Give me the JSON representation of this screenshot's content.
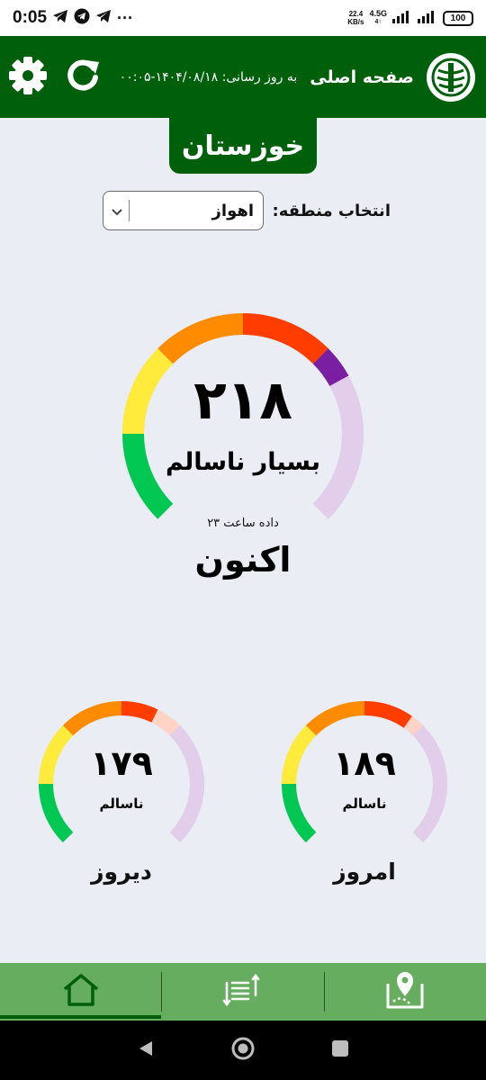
{
  "status_bar": {
    "time": "0:05",
    "more": "···",
    "net_speed_value": "22.4",
    "net_speed_unit": "KB/s",
    "network_type": "4.5G",
    "battery": "100"
  },
  "header": {
    "title": "صفحه اصلی",
    "update_label": "به روز رسانی:",
    "update_value": "۱۴۰۴/۰۸/۱۸-۰۰:۰۵"
  },
  "province": "خوزستان",
  "region": {
    "label": "انتخاب منطقه:",
    "selected": "اهواز"
  },
  "current": {
    "value": "۲۱۸",
    "status": "بسیار ناسالم",
    "data_hour": "داده ساعت ۲۳",
    "label": "اکنون",
    "aqi": 218
  },
  "today": {
    "value": "۱۸۹",
    "status": "ناسالم",
    "label": "امروز",
    "aqi": 189
  },
  "yesterday": {
    "value": "۱۷۹",
    "status": "ناسالم",
    "label": "دیروز",
    "aqi": 179
  },
  "colors": {
    "header_green": "#005f0b",
    "nav_green": "#66ad5f",
    "good": "#00c853",
    "moderate": "#ffeb3b",
    "sensitive": "#ff8c00",
    "unhealthy": "#ff3d00",
    "very_unhealthy": "#7b1fa2",
    "hazardous": "#7e0023"
  }
}
